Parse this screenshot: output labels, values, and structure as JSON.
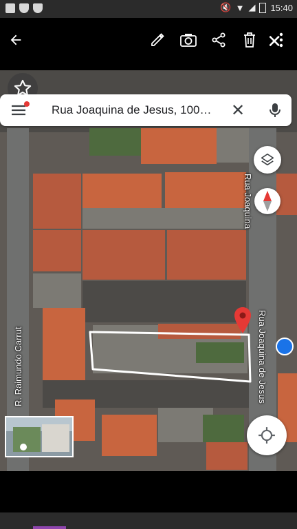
{
  "status_bar": {
    "time": "15:40"
  },
  "top_bar": {
    "actions": [
      "back-arrow-icon",
      "edit-pencil-icon",
      "camera-icon",
      "share-icon",
      "delete-icon",
      "more-vert-icon"
    ]
  },
  "search": {
    "query": "Rua Joaquina de Jesus, 100…"
  },
  "map": {
    "street_labels": {
      "left": "R. Raimundo Carrut",
      "right_top": "Rua Joaquina",
      "right_bottom": "Rua Joaquina de Jesus"
    },
    "pin_color": "#e53935"
  },
  "colors": {
    "accent": "#1a73e8",
    "pin": "#e53935",
    "nav_accent": "#8e44ad"
  }
}
